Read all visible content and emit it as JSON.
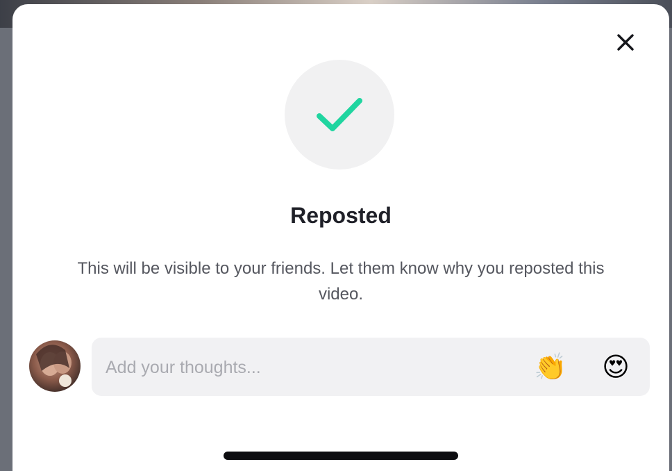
{
  "modal": {
    "title": "Reposted",
    "description": "This will be visible to your friends. Let them know why you reposted this video.",
    "close_icon": "close-icon",
    "status_icon": "checkmark-icon",
    "accent_color": "#20d5a0"
  },
  "composer": {
    "placeholder": "Add your thoughts...",
    "value": "",
    "avatar": "user-avatar",
    "quick_emojis": [
      {
        "name": "clapping-hands-icon",
        "glyph": "👏"
      },
      {
        "name": "heart-eyes-icon",
        "glyph": "😍"
      }
    ]
  }
}
